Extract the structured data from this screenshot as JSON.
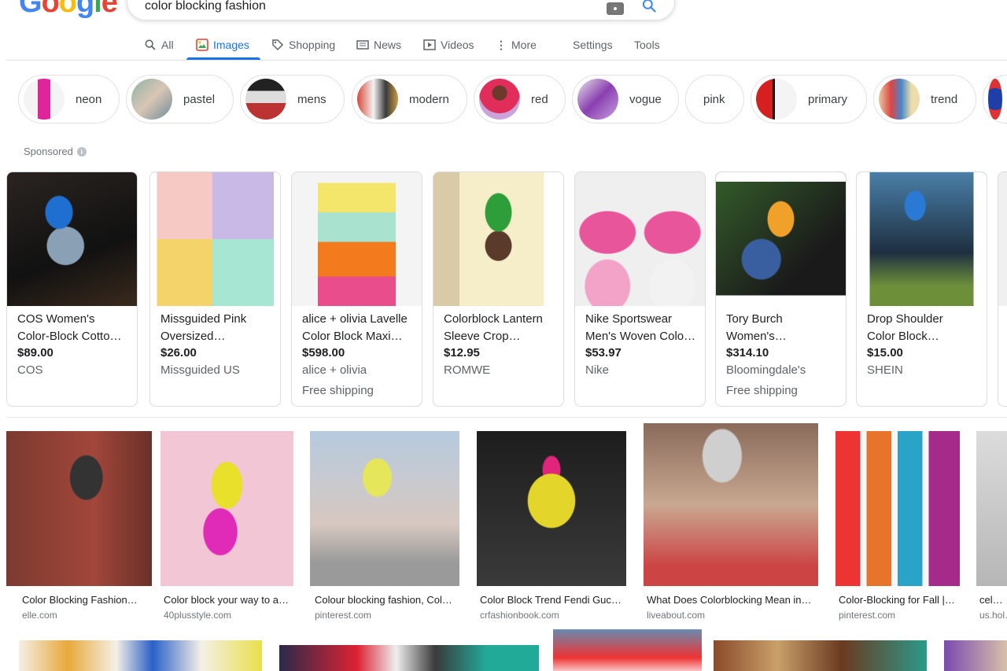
{
  "logo": {
    "text": "Google",
    "letters": [
      "G",
      "o",
      "o",
      "g",
      "l",
      "e"
    ],
    "colors": [
      "#4285f4",
      "#ea4335",
      "#fbbc05",
      "#4285f4",
      "#34a853",
      "#ea4335"
    ]
  },
  "search": {
    "query": "color blocking fashion"
  },
  "tabs": [
    {
      "label": "All",
      "icon": "search-icon"
    },
    {
      "label": "Images",
      "icon": "image-icon",
      "active": true
    },
    {
      "label": "Shopping",
      "icon": "tag-icon"
    },
    {
      "label": "News",
      "icon": "newspaper-icon"
    },
    {
      "label": "Videos",
      "icon": "play-icon"
    },
    {
      "label": "More",
      "icon": "more-vert-icon"
    }
  ],
  "tools": {
    "settings": "Settings",
    "tools": "Tools"
  },
  "chips": [
    {
      "label": "neon"
    },
    {
      "label": "pastel"
    },
    {
      "label": "mens"
    },
    {
      "label": "modern"
    },
    {
      "label": "red"
    },
    {
      "label": "vogue"
    },
    {
      "label": "pink"
    },
    {
      "label": "primary"
    },
    {
      "label": "trend"
    }
  ],
  "sponsored_label": "Sponsored",
  "products": [
    {
      "title1": "COS Women's",
      "title2": "Color-Block Cotto…",
      "price": "$89.00",
      "store": "COS",
      "shipping": ""
    },
    {
      "title1": "Missguided Pink",
      "title2": "Oversized…",
      "price": "$26.00",
      "store": "Missguided US",
      "shipping": ""
    },
    {
      "title1": "alice + olivia Lavelle",
      "title2": "Color Block Maxi…",
      "price": "$598.00",
      "store": "alice + olivia",
      "shipping": "Free shipping"
    },
    {
      "title1": "Colorblock Lantern",
      "title2": "Sleeve Crop…",
      "price": "$12.95",
      "store": "ROMWE",
      "shipping": ""
    },
    {
      "title1": "Nike Sportswear",
      "title2": "Men's Woven Colo…",
      "price": "$53.97",
      "store": "Nike",
      "shipping": ""
    },
    {
      "title1": "Tory Burch",
      "title2": "Women's…",
      "price": "$314.10",
      "store": "Bloomingdale's",
      "shipping": "Free shipping"
    },
    {
      "title1": "Drop Shoulder",
      "title2": "Color Block…",
      "price": "$15.00",
      "store": "SHEIN",
      "shipping": ""
    }
  ],
  "results": [
    {
      "title": "Color Blocking Fashion…",
      "domain": "elle.com"
    },
    {
      "title": "Color block your way to a…",
      "domain": "40plusstyle.com"
    },
    {
      "title": "Colour blocking fashion, Col…",
      "domain": "pinterest.com"
    },
    {
      "title": "Color Block Trend Fendi Guc…",
      "domain": "crfashionbook.com"
    },
    {
      "title": "What Does Colorblocking Mean in…",
      "domain": "liveabout.com"
    },
    {
      "title": "Color-Blocking for Fall |…",
      "domain": "pinterest.com"
    },
    {
      "title": "celeb…",
      "domain": "us.hol…"
    }
  ],
  "colors": {
    "accent": "#1a73e8",
    "text": "#202124",
    "muted": "#5f6368"
  }
}
